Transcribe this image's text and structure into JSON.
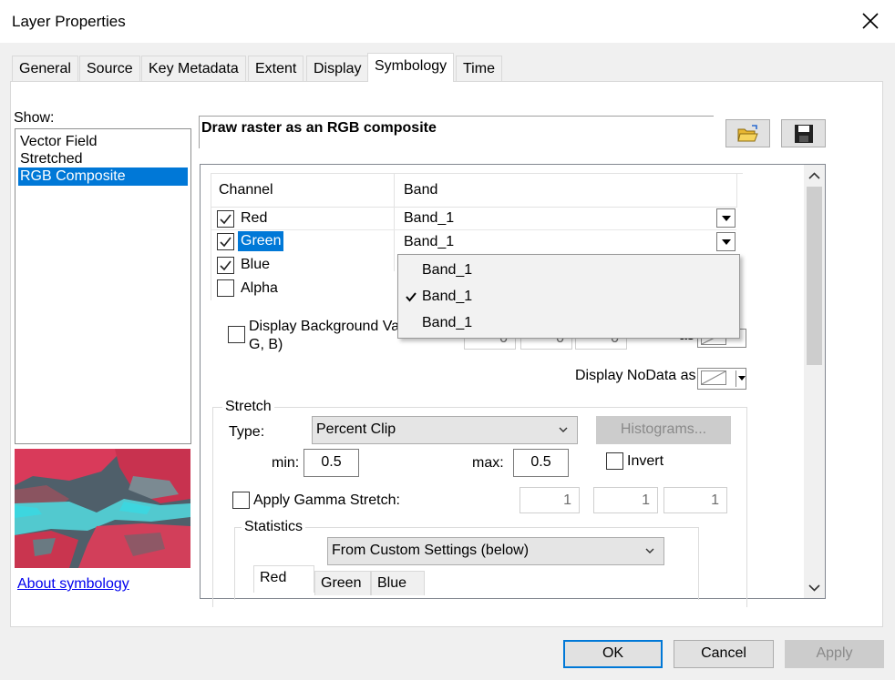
{
  "window": {
    "title": "Layer Properties"
  },
  "tabs": [
    {
      "label": "General"
    },
    {
      "label": "Source"
    },
    {
      "label": "Key Metadata"
    },
    {
      "label": "Extent"
    },
    {
      "label": "Display"
    },
    {
      "label": "Symbology",
      "active": true
    },
    {
      "label": "Time"
    }
  ],
  "show": {
    "label": "Show:",
    "items": [
      "Vector Field",
      "Stretched",
      "RGB Composite"
    ],
    "selected": "RGB Composite"
  },
  "about_link": "About symbology",
  "heading": "Draw raster as an RGB composite",
  "toolbar_icons": [
    "open-folder-icon",
    "save-disk-icon"
  ],
  "channels": {
    "header_channel": "Channel",
    "header_band": "Band",
    "rows": [
      {
        "name": "Red",
        "checked": true,
        "band": "Band_1"
      },
      {
        "name": "Green",
        "checked": true,
        "band": "Band_1",
        "selected": true
      },
      {
        "name": "Blue",
        "checked": true,
        "band": ""
      },
      {
        "name": "Alpha",
        "checked": false,
        "band": ""
      }
    ]
  },
  "band_dropdown": {
    "options": [
      "Band_1",
      "Band_1",
      "Band_1"
    ],
    "checked_index": 1
  },
  "background": {
    "label_line1": "Display Background Va",
    "label_line2": "G, B)",
    "values": [
      "0",
      "0",
      "0"
    ],
    "as_label": "as"
  },
  "nodata": {
    "label": "Display NoData as"
  },
  "stretch": {
    "group_label": "Stretch",
    "type_label": "Type:",
    "type_value": "Percent Clip",
    "histograms_button": "Histograms...",
    "min_label": "min:",
    "min_value": "0.5",
    "max_label": "max:",
    "max_value": "0.5",
    "invert_label": "Invert",
    "gamma_label": "Apply Gamma Stretch:",
    "gamma_values": [
      "1",
      "1",
      "1"
    ]
  },
  "statistics": {
    "group_label": "Statistics",
    "source_value": "From Custom Settings (below)",
    "tabs": [
      "Red",
      "Green",
      "Blue"
    ]
  },
  "buttons": {
    "ok": "OK",
    "cancel": "Cancel",
    "apply": "Apply"
  },
  "colors": {
    "selection": "#0078d7",
    "link": "#0000ee"
  }
}
